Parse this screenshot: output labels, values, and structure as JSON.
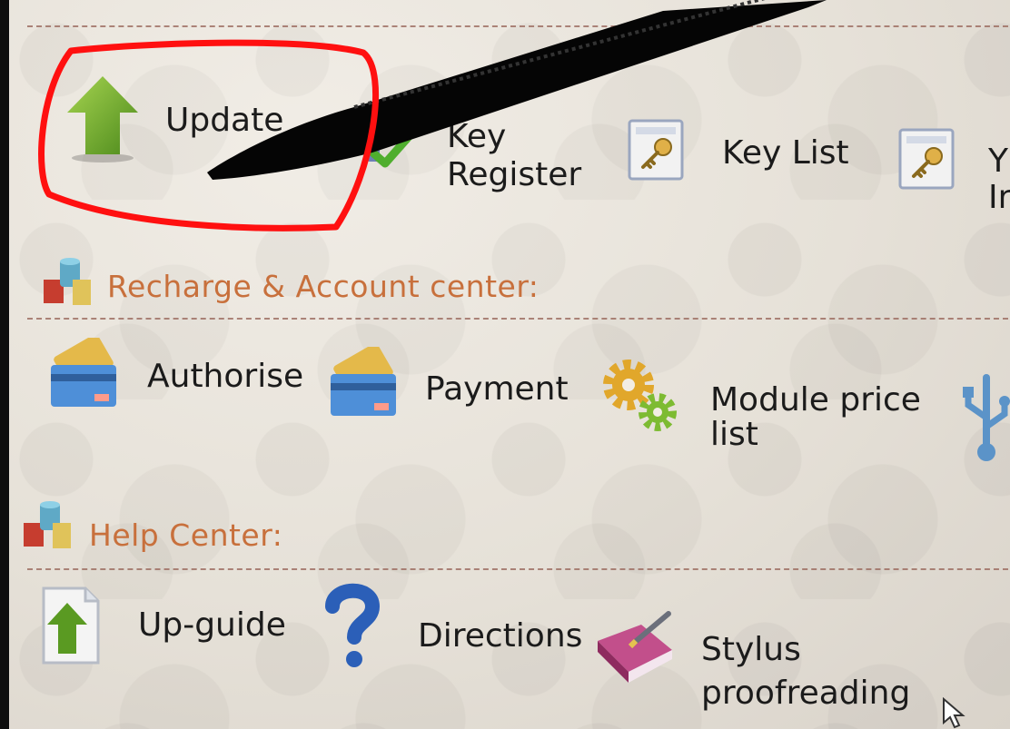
{
  "tools": {
    "update": "Update",
    "key_register": "Key\nRegister",
    "key_list": "Key List",
    "partial_right": "Y\nIr"
  },
  "recharge": {
    "title": "Recharge & Account center:",
    "authorise": "Authorise",
    "payment": "Payment",
    "module_price_list": "Module price\nlist"
  },
  "help": {
    "title": "Help Center:",
    "up_guide": "Up-guide",
    "directions": "Directions",
    "stylus_proofreading": "Stylus\nproofreading"
  },
  "icons": {
    "update": "up-arrow-icon",
    "key_register": "checkmark-icon",
    "key_list": "key-document-icon",
    "recharge": "database-icon",
    "authorise": "credit-card-icon",
    "payment": "credit-card-icon",
    "module_price_list": "gears-icon",
    "usb": "usb-icon",
    "help": "database-icon",
    "up_guide": "document-arrow-icon",
    "directions": "question-mark-icon",
    "stylus_proofreading": "book-pen-icon"
  },
  "colors": {
    "section_title": "#c8703c",
    "highlight_circle": "#ff0000",
    "divider": "#9b6a5e"
  }
}
